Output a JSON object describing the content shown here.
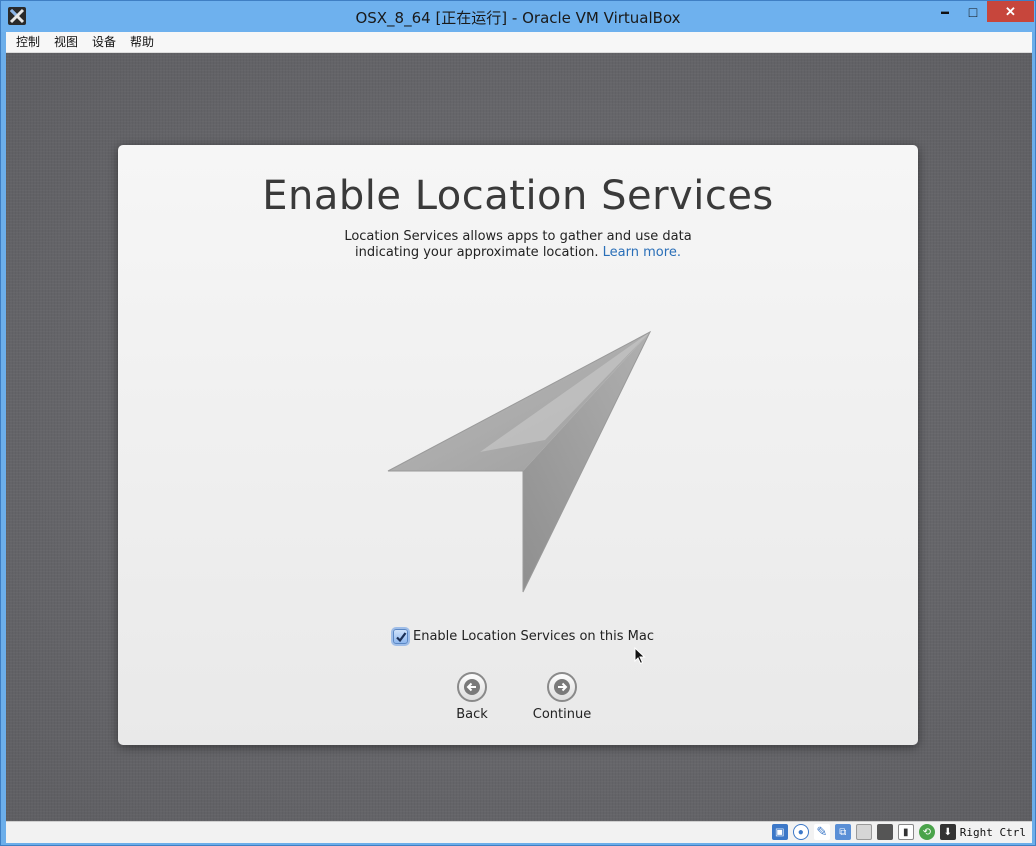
{
  "window": {
    "title": "OSX_8_64 [正在运行] - Oracle VM VirtualBox",
    "minimize_glyph": "▬",
    "maximize_glyph": "□",
    "close_glyph": "✕"
  },
  "menubar": {
    "items": [
      "控制",
      "视图",
      "设备",
      "帮助"
    ]
  },
  "setup": {
    "title": "Enable Location Services",
    "description_line1": "Location Services allows apps to gather and use data",
    "description_line2": "indicating your approximate location.",
    "learn_more": "Learn more.",
    "checkbox_label": "Enable Location Services on this Mac",
    "checkbox_checked": true,
    "back_label": "Back",
    "continue_label": "Continue"
  },
  "statusbar": {
    "host_key": "Right Ctrl",
    "icons": [
      "hard-disk-icon",
      "optical-drive-icon",
      "usb-icon",
      "network-icon",
      "shared-folder-icon",
      "display-icon",
      "recording-icon",
      "guest-additions-icon",
      "mouse-integration-icon"
    ]
  },
  "colors": {
    "titlebar": "#6eb1ee",
    "close_button": "#c7463c",
    "link": "#2a6fb8",
    "desktop": "#6b6b6f"
  }
}
